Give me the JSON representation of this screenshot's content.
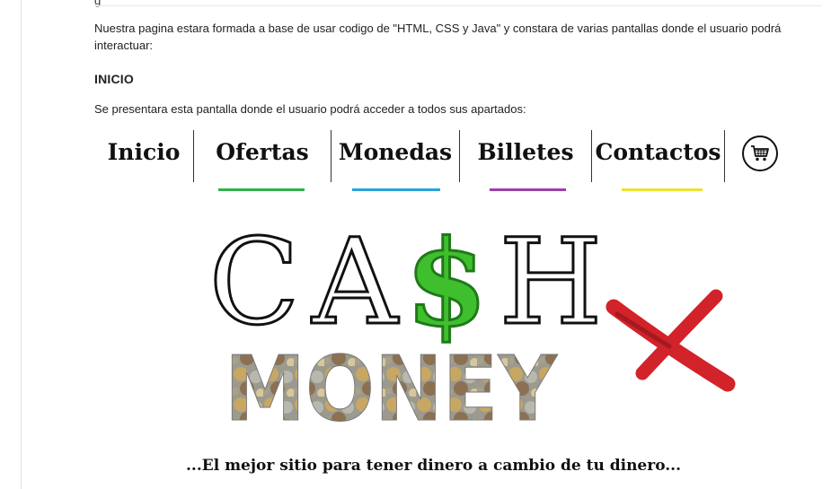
{
  "intro": "Nuestra pagina estara formada a base de usar codigo de \"HTML, CSS y Java\" y constara de varias pantallas donde el usuario podrá interactuar:",
  "section_title": "INICIO",
  "section_text": "Se presentara esta pantalla donde el usuario podrá acceder a todos sus apartados:",
  "nav": {
    "items": [
      {
        "label": "Inicio",
        "underline": null
      },
      {
        "label": "Ofertas",
        "underline": "#2eb34a"
      },
      {
        "label": "Monedas",
        "underline": "#29a3dc"
      },
      {
        "label": "Billetes",
        "underline": "#9b3fa9"
      },
      {
        "label": "Contactos",
        "underline": "#eee231"
      }
    ],
    "cart_icon": "shopping-cart-icon"
  },
  "logo": {
    "letters": [
      "C",
      "A",
      "$",
      "H"
    ],
    "word": "MONEY",
    "dollar_color": "#3fbf2e",
    "x_color": "#d2222a"
  },
  "tagline": "...El mejor sitio para tener dinero a cambio de tu dinero..."
}
